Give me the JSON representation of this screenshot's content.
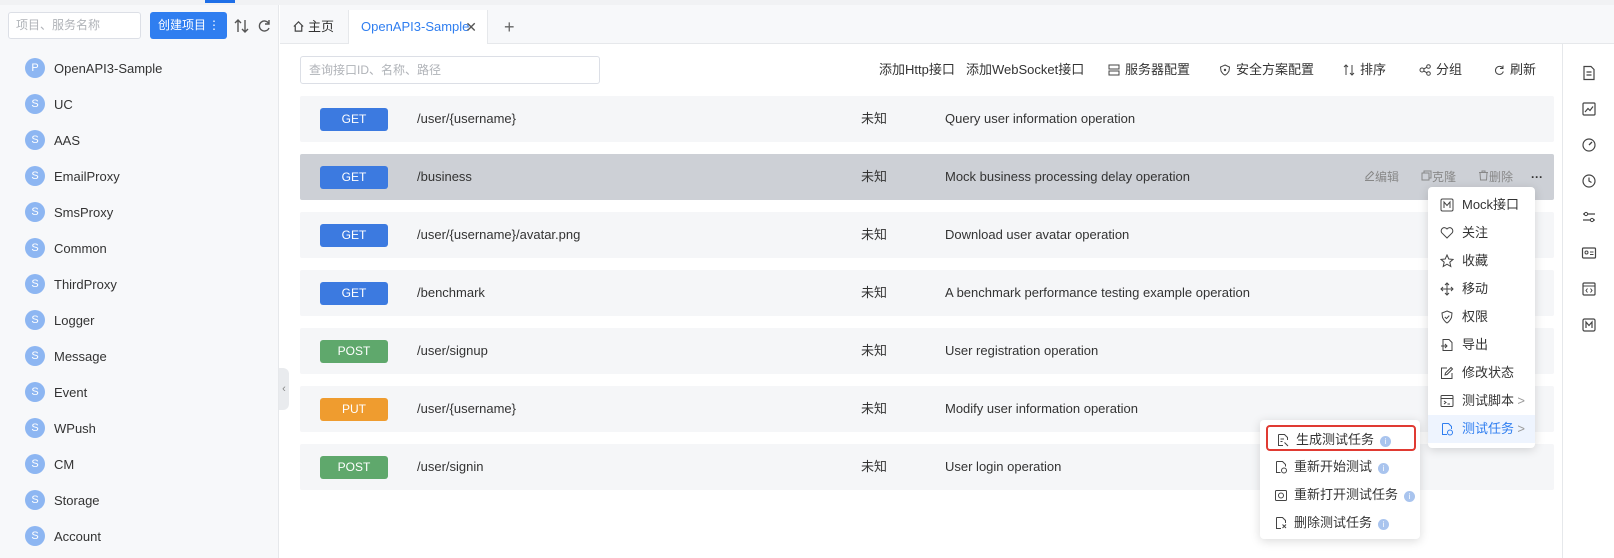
{
  "sidebar": {
    "search_placeholder": "项目、服务名称",
    "create_label": "创建项目",
    "create_more": "⋮",
    "items": [
      {
        "badge": "P",
        "label": "OpenAPI3-Sample"
      },
      {
        "badge": "S",
        "label": "UC"
      },
      {
        "badge": "S",
        "label": "AAS"
      },
      {
        "badge": "S",
        "label": "EmailProxy"
      },
      {
        "badge": "S",
        "label": "SmsProxy"
      },
      {
        "badge": "S",
        "label": "Common"
      },
      {
        "badge": "S",
        "label": "ThirdProxy"
      },
      {
        "badge": "S",
        "label": "Logger"
      },
      {
        "badge": "S",
        "label": "Message"
      },
      {
        "badge": "S",
        "label": "Event"
      },
      {
        "badge": "S",
        "label": "WPush"
      },
      {
        "badge": "S",
        "label": "CM"
      },
      {
        "badge": "S",
        "label": "Storage"
      },
      {
        "badge": "S",
        "label": "Account"
      }
    ]
  },
  "tabs": {
    "home": "主页",
    "active": "OpenAPI3-Sample",
    "close": "✕",
    "add": "+"
  },
  "toolbar": {
    "search_placeholder": "查询接口ID、名称、路径",
    "add_http": "添加Http接口",
    "add_ws": "添加WebSocket接口",
    "server_config": "服务器配置",
    "security_config": "安全方案配置",
    "sort": "排序",
    "group": "分组",
    "refresh": "刷新"
  },
  "apis": [
    {
      "method": "GET",
      "path": "/user/{username}",
      "status": "未知",
      "desc": "Query user information operation"
    },
    {
      "method": "GET",
      "path": "/business",
      "status": "未知",
      "desc": "Mock business processing delay operation"
    },
    {
      "method": "GET",
      "path": "/user/{username}/avatar.png",
      "status": "未知",
      "desc": "Download user avatar operation"
    },
    {
      "method": "GET",
      "path": "/benchmark",
      "status": "未知",
      "desc": "A benchmark performance testing example operation"
    },
    {
      "method": "POST",
      "path": "/user/signup",
      "status": "未知",
      "desc": "User registration operation"
    },
    {
      "method": "PUT",
      "path": "/user/{username}",
      "status": "未知",
      "desc": "Modify user information operation"
    },
    {
      "method": "POST",
      "path": "/user/signin",
      "status": "未知",
      "desc": "User login operation"
    }
  ],
  "row_actions": {
    "edit": "编辑",
    "clone": "克隆",
    "delete": "删除",
    "more": "···"
  },
  "menu": {
    "items": [
      "Mock接口",
      "关注",
      "收藏",
      "移动",
      "权限",
      "导出",
      "修改状态",
      "测试脚本",
      "测试任务"
    ],
    "chevron": ">"
  },
  "submenu": {
    "items": [
      "生成测试任务",
      "重新开始测试",
      "重新打开测试任务",
      "删除测试任务"
    ],
    "info": "i"
  },
  "colors": {
    "primary": "#2f7ef0",
    "get": "#3c7ae0",
    "post": "#5fa86c",
    "put": "#ef9c2f",
    "highlight_border": "#e03a32"
  }
}
